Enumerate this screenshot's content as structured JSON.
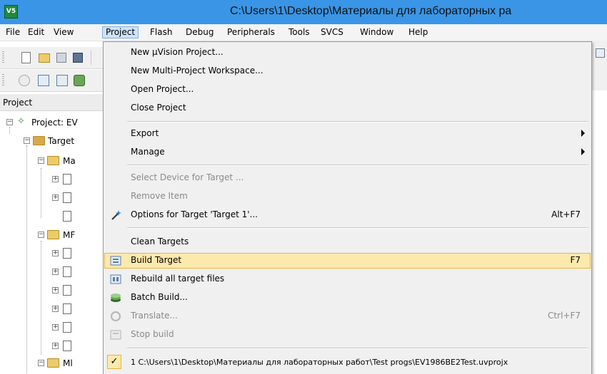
{
  "window": {
    "title": "C:\\Users\\1\\Desktop\\Материалы для лабораторных ра",
    "app_icon_text": "V5"
  },
  "menubar": {
    "items": [
      "File",
      "Edit",
      "View",
      "Project",
      "Flash",
      "Debug",
      "Peripherals",
      "Tools",
      "SVCS",
      "Window",
      "Help"
    ],
    "active": "Project"
  },
  "project_panel": {
    "title": "Project",
    "tree": {
      "root": "Project: EV",
      "target": "Target",
      "group1": "Ma",
      "group2": "MF",
      "group3": "Ml"
    }
  },
  "project_menu": {
    "new_uvision_project": "New µVision Project...",
    "new_multi_project": "New Multi-Project Workspace...",
    "open_project": "Open Project...",
    "close_project": "Close Project",
    "export": "Export",
    "manage": "Manage",
    "select_device": "Select Device for Target ...",
    "remove_item": "Remove Item",
    "options_for_target": "Options for Target 'Target 1'...",
    "options_shortcut": "Alt+F7",
    "clean_targets": "Clean Targets",
    "build_target": "Build Target",
    "build_shortcut": "F7",
    "rebuild_all": "Rebuild all target files",
    "batch_build": "Batch Build...",
    "translate": "Translate...",
    "translate_shortcut": "Ctrl+F7",
    "stop_build": "Stop build",
    "recent_project": "1 C:\\Users\\1\\Desktop\\Материалы для лабораторных работ\\Test progs\\EV1986BE2Test.uvprojx",
    "recent_check": "✓"
  },
  "colors": {
    "titlebar": "#3a95e6",
    "menu_highlight": "#fde9ac",
    "menu_highlight_border": "#e8b347",
    "active_menu": "#cfe3f8"
  }
}
